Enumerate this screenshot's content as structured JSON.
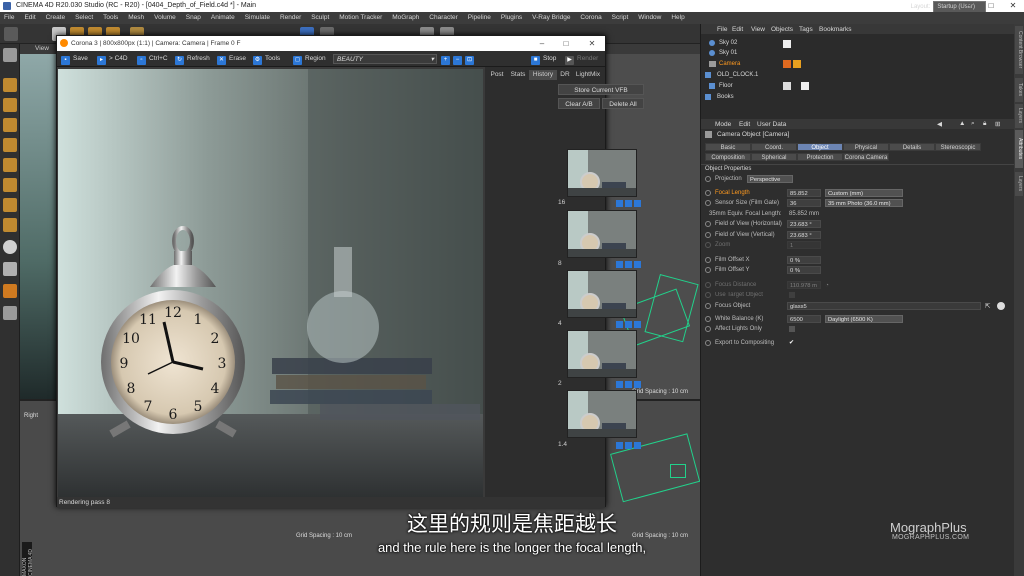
{
  "window": {
    "title": "CINEMA 4D R20.030 Studio (RC - R20) - [0404_Depth_of_Field.c4d *] - Main",
    "minimize": "–",
    "maximize": "□",
    "close": "✕"
  },
  "menu": [
    "File",
    "Edit",
    "Create",
    "Select",
    "Tools",
    "Mesh",
    "Volume",
    "Snap",
    "Animate",
    "Simulate",
    "Render",
    "Sculpt",
    "Motion Tracker",
    "MoGraph",
    "Character",
    "Pipeline",
    "Plugins",
    "V-Ray Bridge",
    "Corona",
    "Script",
    "Window",
    "Help"
  ],
  "layout": {
    "label": "Layout:",
    "value": "Startup (User)"
  },
  "viewport": {
    "menu_label": "View",
    "right_label": "Right",
    "grid_spacing": "Grid Spacing : 10 cm"
  },
  "corona": {
    "title": "Corona 3 | 800x800px (1:1) | Camera: Camera | Frame 0 F",
    "toolbar": {
      "save": "Save",
      "c4d": "> C4D",
      "ctrlc": "Ctrl+C",
      "refresh": "Refresh",
      "erase": "Erase",
      "tools": "Tools",
      "region": "Region",
      "channel": "BEAUTY",
      "stop": "Stop",
      "render": "Render"
    },
    "tabs": [
      "Post",
      "Stats",
      "History",
      "DR",
      "LightMix"
    ],
    "active_tab": "History",
    "store_btn": "Store Current VFB",
    "clear_btn": "Clear A/B",
    "delete_btn": "Delete All",
    "history": [
      {
        "label": "16"
      },
      {
        "label": "8"
      },
      {
        "label": "4"
      },
      {
        "label": "2"
      },
      {
        "label": "1.4"
      }
    ],
    "status": "Rendering pass 8"
  },
  "objects": {
    "menu": [
      "File",
      "Edit",
      "View",
      "Objects",
      "Tags",
      "Bookmarks"
    ],
    "items": [
      {
        "name": "Sky 02",
        "indent": 1
      },
      {
        "name": "Sky 01",
        "indent": 1
      },
      {
        "name": "Camera",
        "indent": 1,
        "selected": true
      },
      {
        "name": "OLD_CLOCK.1",
        "indent": 0
      },
      {
        "name": "Floor",
        "indent": 1
      },
      {
        "name": "Books",
        "indent": 0
      }
    ]
  },
  "attributes": {
    "menu": [
      "Mode",
      "Edit",
      "User Data"
    ],
    "header": "Camera Object [Camera]",
    "tabs_row1": [
      "Basic",
      "Coord.",
      "Object",
      "Physical",
      "Details",
      "Stereoscopic"
    ],
    "tabs_row2": [
      "Composition",
      "Spherical",
      "Protection",
      "Corona Camera"
    ],
    "active_tab": "Object",
    "section": "Object Properties",
    "projection": {
      "label": "Projection",
      "value": "Perspective"
    },
    "focal_length": {
      "label": "Focal Length",
      "value": "85.852",
      "preset": "Custom (mm)"
    },
    "sensor": {
      "label": "Sensor Size (Film Gate)",
      "value": "36",
      "preset": "35 mm Photo (36.0 mm)"
    },
    "equiv": {
      "label": "35mm Equiv. Focal Length:",
      "value": "85.852 mm"
    },
    "fov_h": {
      "label": "Field of View (Horizontal)",
      "value": "23.683 °"
    },
    "fov_v": {
      "label": "Field of View (Vertical)",
      "value": "23.683 °"
    },
    "zoom": {
      "label": "Zoom",
      "value": "1"
    },
    "film_x": {
      "label": "Film Offset X",
      "value": "0 %"
    },
    "film_y": {
      "label": "Film Offset Y",
      "value": "0 %"
    },
    "focus_dist": {
      "label": "Focus Distance",
      "value": "110.978 m"
    },
    "use_target": {
      "label": "Use Target Object",
      "value": ""
    },
    "focus_obj": {
      "label": "Focus Object",
      "value": "glass5"
    },
    "white_balance": {
      "label": "White Balance (K)",
      "value": "6500",
      "preset": "Daylight (6500 K)"
    },
    "affect_lights": {
      "label": "Affect Lights Only",
      "value": ""
    },
    "export": {
      "label": "Export to Compositing",
      "value": "✔"
    }
  },
  "side_tabs": [
    "Content Browser",
    "Takes",
    "Layers",
    "Attributes",
    "Layers"
  ],
  "subtitle": {
    "cn": "这里的规则是焦距越长",
    "en": "and the rule here is the longer the focal length,"
  },
  "watermark": {
    "brand": "MographPlus",
    "url": "MOGRAPHPLUS.COM"
  },
  "maxon": "MAXON CINEMA 4D"
}
